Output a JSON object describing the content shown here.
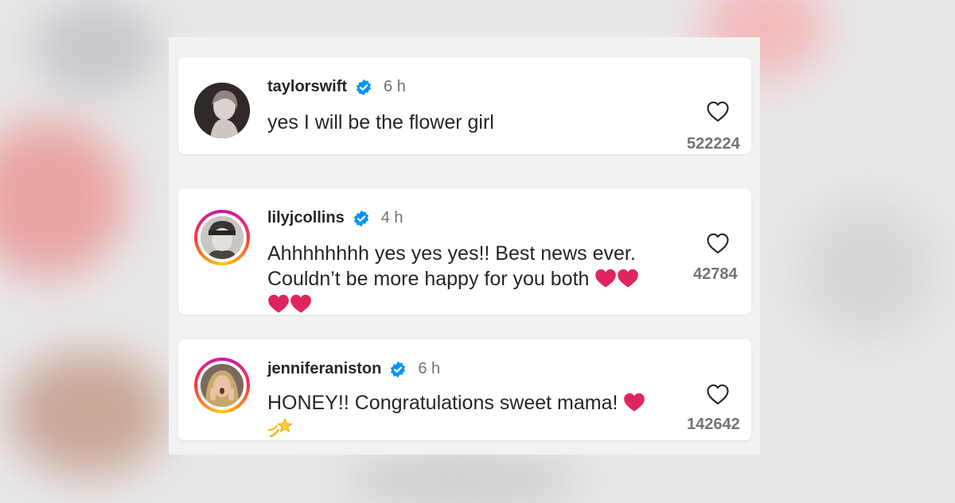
{
  "comments": [
    {
      "username": "taylorswift",
      "time": "6 h",
      "text": "yes I will be the flower girl",
      "likes": "522224",
      "avatar_icon": "avatar-photo",
      "story_ring": false
    },
    {
      "username": "lilyjcollins",
      "time": "4 h",
      "text_line1": "Ahhhhhhhh yes yes yes!! Best news ever.",
      "text_line2": "Couldn’t be more happy for you both",
      "likes": "42784",
      "avatar_icon": "avatar-photo",
      "story_ring": true
    },
    {
      "username": "jenniferaniston",
      "time": "6 h",
      "text": "HONEY!! Congratulations sweet mama!",
      "likes": "142642",
      "avatar_icon": "avatar-photo",
      "story_ring": true
    }
  ],
  "icons": {
    "verified": "verified-badge-icon",
    "like": "heart-outline-icon",
    "emoji_heart": "red-heart-emoji",
    "emoji_dizzy": "dizzy-star-emoji"
  },
  "colors": {
    "verified": "#0095f6",
    "heart_emoji": "#e0245e",
    "muted": "#737373",
    "text": "#262626"
  }
}
